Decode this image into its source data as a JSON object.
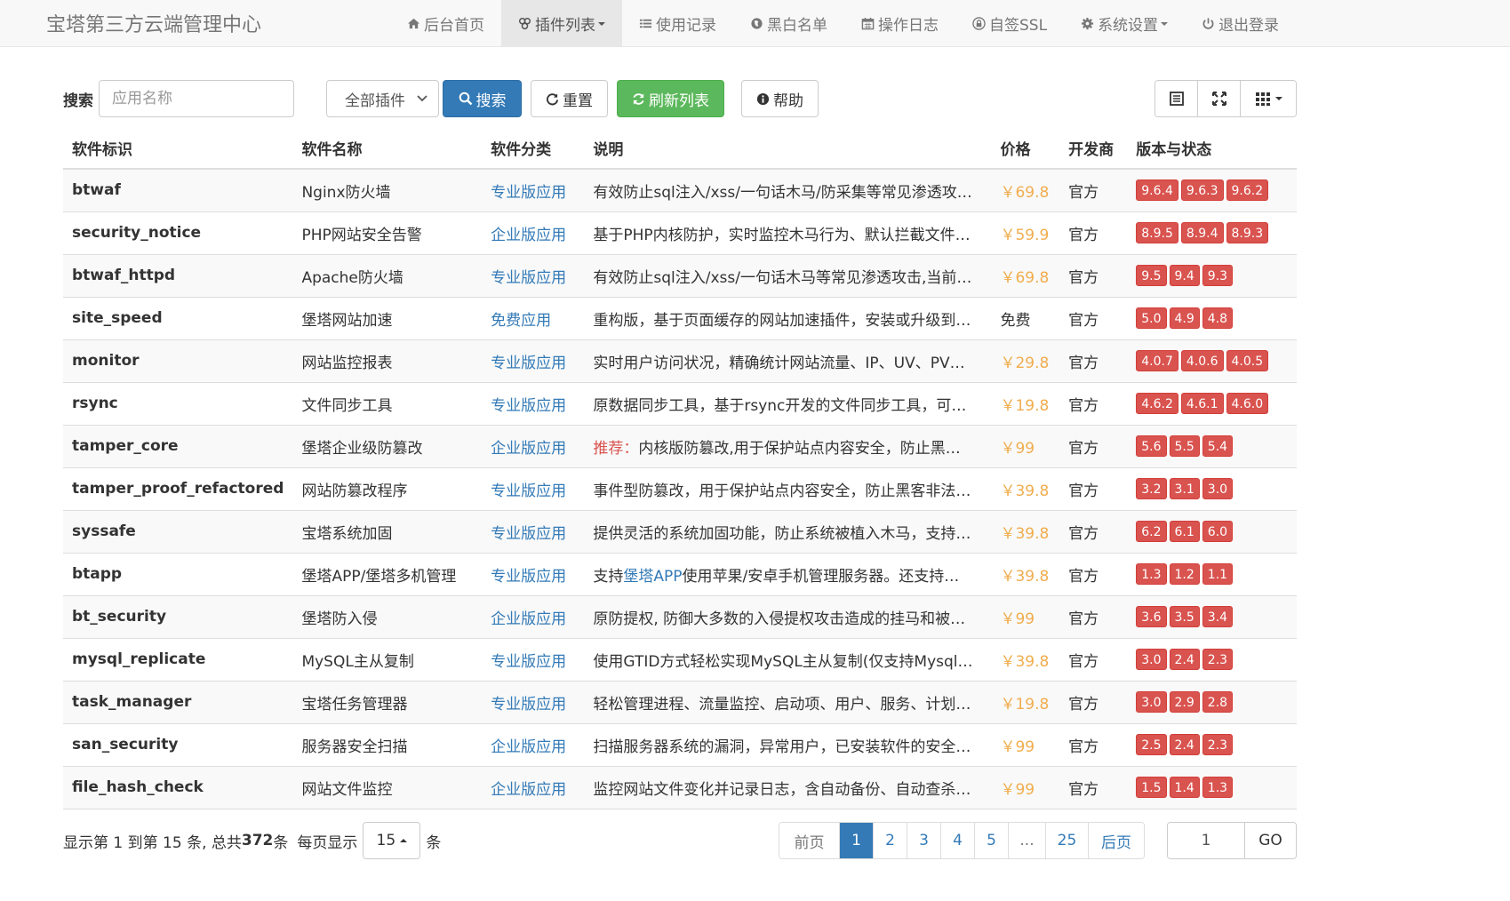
{
  "brand": "宝塔第三方云端管理中心",
  "nav": [
    {
      "label": "后台首页",
      "icon": "home-icon"
    },
    {
      "label": "插件列表",
      "icon": "cubes-icon",
      "active": true,
      "dropdown": true
    },
    {
      "label": "使用记录",
      "icon": "list-icon"
    },
    {
      "label": "黑白名单",
      "icon": "globe-icon"
    },
    {
      "label": "操作日志",
      "icon": "calendar-icon"
    },
    {
      "label": "自签SSL",
      "icon": "lock-icon"
    },
    {
      "label": "系统设置",
      "icon": "gear-icon",
      "dropdown": true
    },
    {
      "label": "退出登录",
      "icon": "power-icon"
    }
  ],
  "toolbar": {
    "search_label": "搜索",
    "search_placeholder": "应用名称",
    "filter_value": "全部插件",
    "search_button": "搜索",
    "reset_button": "重置",
    "refresh_button": "刷新列表",
    "help_button": "帮助"
  },
  "table": {
    "headers": [
      "软件标识",
      "软件名称",
      "软件分类",
      "说明",
      "价格",
      "开发商",
      "版本与状态"
    ],
    "rows": [
      {
        "id": "btwaf",
        "name": "Nginx防火墙",
        "category": "专业版应用",
        "desc": "有效防止sql注入/xss/一句话木马/防采集等常见渗透攻…",
        "price": "￥69.8",
        "dev": "官方",
        "versions": [
          "9.6.4",
          "9.6.3",
          "9.6.2"
        ]
      },
      {
        "id": "security_notice",
        "name": "PHP网站安全告警",
        "category": "企业版应用",
        "desc": "基于PHP内核防护，实时监控木马行为、默认拦截文件…",
        "price": "￥59.9",
        "dev": "官方",
        "versions": [
          "8.9.5",
          "8.9.4",
          "8.9.3"
        ]
      },
      {
        "id": "btwaf_httpd",
        "name": "Apache防火墙",
        "category": "专业版应用",
        "desc": "有效防止sql注入/xss/一句话木马等常见渗透攻击,当前…",
        "price": "￥69.8",
        "dev": "官方",
        "versions": [
          "9.5",
          "9.4",
          "9.3"
        ]
      },
      {
        "id": "site_speed",
        "name": "堡塔网站加速",
        "category": "免费应用",
        "desc": "重构版，基于页面缓存的网站加速插件，安装或升级到…",
        "price": "免费",
        "dev": "官方",
        "versions": [
          "5.0",
          "4.9",
          "4.8"
        ]
      },
      {
        "id": "monitor",
        "name": "网站监控报表",
        "category": "专业版应用",
        "desc": "实时用户访问状况，精确统计网站流量、IP、UV、PV…",
        "price": "￥29.8",
        "dev": "官方",
        "versions": [
          "4.0.7",
          "4.0.6",
          "4.0.5"
        ]
      },
      {
        "id": "rsync",
        "name": "文件同步工具",
        "category": "专业版应用",
        "desc": "原数据同步工具，基于rsync开发的文件同步工具，可…",
        "price": "￥19.8",
        "dev": "官方",
        "versions": [
          "4.6.2",
          "4.6.1",
          "4.6.0"
        ]
      },
      {
        "id": "tamper_core",
        "name": "堡塔企业级防篡改",
        "category": "企业版应用",
        "desc_prefix": "推荐：",
        "desc": "内核版防篡改,用于保护站点内容安全，防止黑…",
        "price": "￥99",
        "dev": "官方",
        "versions": [
          "5.6",
          "5.5",
          "5.4"
        ]
      },
      {
        "id": "tamper_proof_refactored",
        "name": "网站防篡改程序",
        "category": "专业版应用",
        "desc": "事件型防篡改，用于保护站点内容安全，防止黑客非法…",
        "price": "￥39.8",
        "dev": "官方",
        "versions": [
          "3.2",
          "3.1",
          "3.0"
        ]
      },
      {
        "id": "syssafe",
        "name": "宝塔系统加固",
        "category": "专业版应用",
        "desc": "提供灵活的系统加固功能，防止系统被植入木马，支持…",
        "price": "￥39.8",
        "dev": "官方",
        "versions": [
          "6.2",
          "6.1",
          "6.0"
        ]
      },
      {
        "id": "btapp",
        "name": "堡塔APP/堡塔多机管理",
        "category": "专业版应用",
        "desc_a": "支持",
        "desc_link": "堡塔APP",
        "desc": "使用苹果/安卓手机管理服务器。还支持…",
        "price": "￥39.8",
        "dev": "官方",
        "versions": [
          "1.3",
          "1.2",
          "1.1"
        ]
      },
      {
        "id": "bt_security",
        "name": "堡塔防入侵",
        "category": "企业版应用",
        "desc": "原防提权, 防御大多数的入侵提权攻击造成的挂马和被…",
        "price": "￥99",
        "dev": "官方",
        "versions": [
          "3.6",
          "3.5",
          "3.4"
        ]
      },
      {
        "id": "mysql_replicate",
        "name": "MySQL主从复制",
        "category": "专业版应用",
        "desc": "使用GTID方式轻松实现MySQL主从复制(仅支持Mysql…",
        "price": "￥39.8",
        "dev": "官方",
        "versions": [
          "3.0",
          "2.4",
          "2.3"
        ]
      },
      {
        "id": "task_manager",
        "name": "宝塔任务管理器",
        "category": "专业版应用",
        "desc": "轻松管理进程、流量监控、启动项、用户、服务、计划…",
        "price": "￥19.8",
        "dev": "官方",
        "versions": [
          "3.0",
          "2.9",
          "2.8"
        ]
      },
      {
        "id": "san_security",
        "name": "服务器安全扫描",
        "category": "企业版应用",
        "desc": "扫描服务器系统的漏洞，异常用户，已安装软件的安全…",
        "price": "￥99",
        "dev": "官方",
        "versions": [
          "2.5",
          "2.4",
          "2.3"
        ]
      },
      {
        "id": "file_hash_check",
        "name": "网站文件监控",
        "category": "企业版应用",
        "desc": "监控网站文件变化并记录日志，含自动备份、自动查杀…",
        "price": "￥99",
        "dev": "官方",
        "versions": [
          "1.5",
          "1.4",
          "1.3"
        ]
      }
    ]
  },
  "footer": {
    "info_a": "显示第 1 到第 15 条, 总共 ",
    "total": "372",
    "info_b": " 条",
    "per_page_label": "每页显示",
    "per_page": "15",
    "per_page_unit": "条"
  },
  "pagination": {
    "items": [
      "前页",
      "1",
      "2",
      "3",
      "4",
      "5",
      "...",
      "25",
      "后页"
    ],
    "current": "1",
    "goto_value": "1",
    "goto_button": "GO"
  }
}
